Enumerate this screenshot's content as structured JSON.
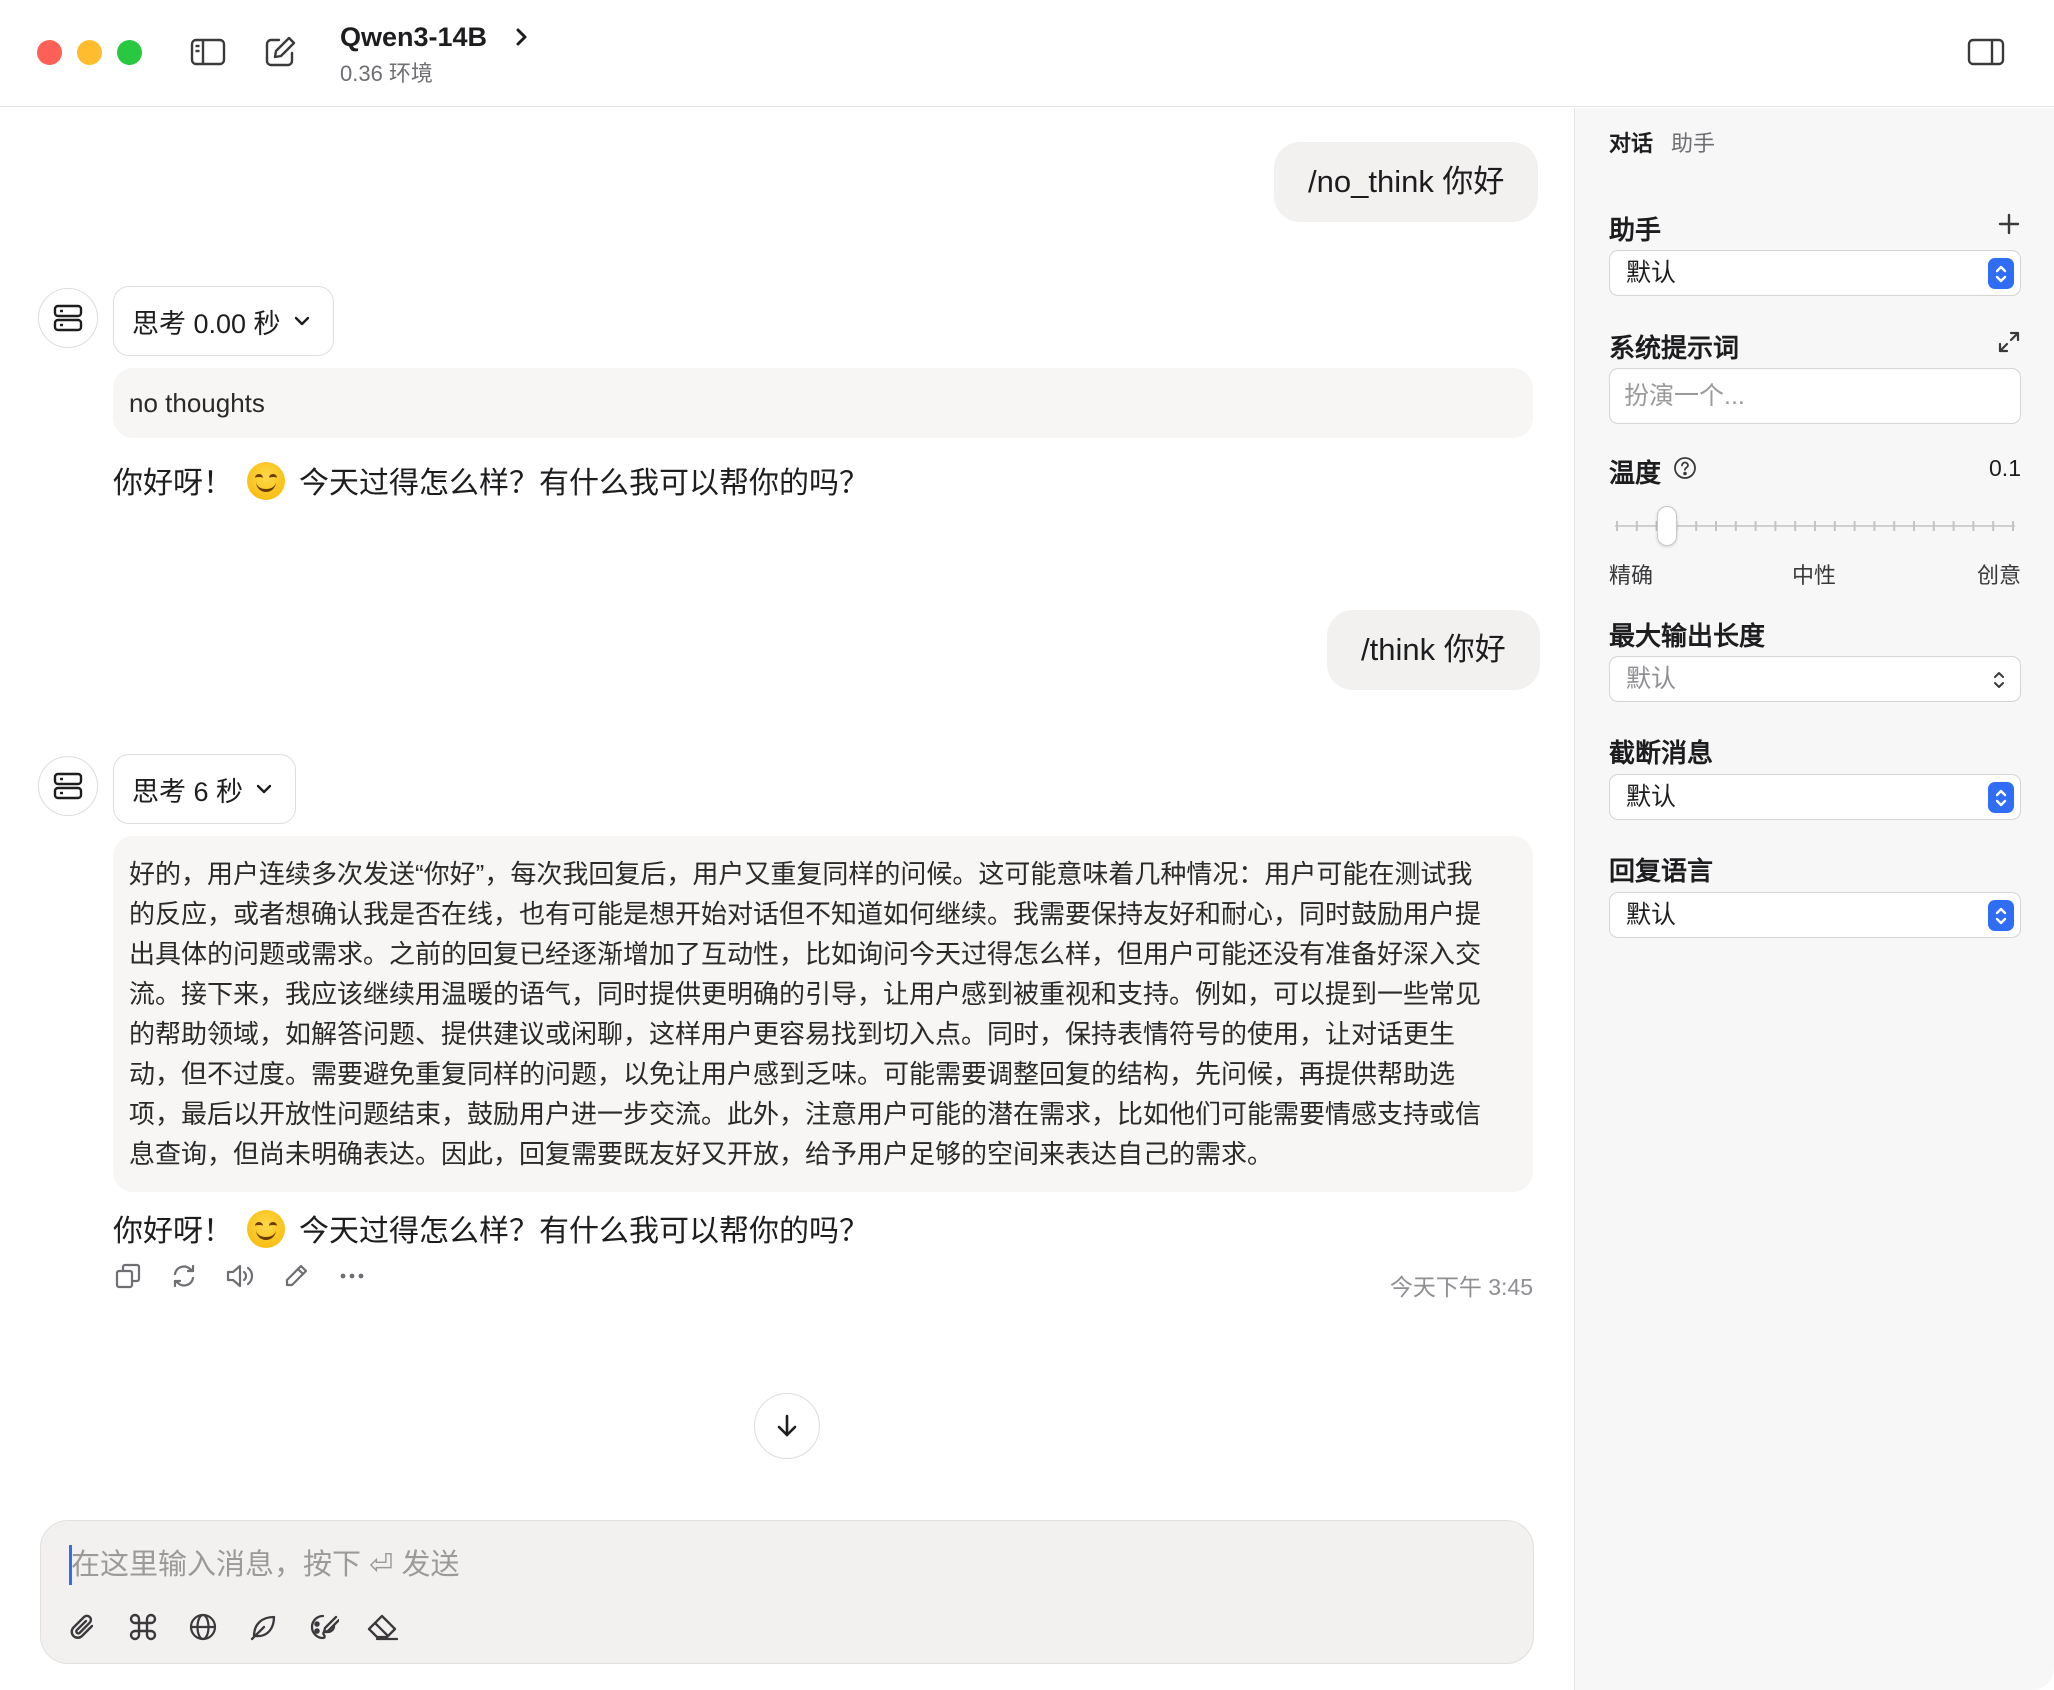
{
  "window": {
    "model_name": "Qwen3-14B",
    "model_subtitle": "0.36 环境"
  },
  "conversation": {
    "user_message_1": "/no_think 你好",
    "thinking_1": {
      "label": "思考 0.00 秒",
      "content": "no thoughts"
    },
    "answer_1": {
      "before_emoji": "你好呀！",
      "emoji": "smiling-face",
      "after_emoji": "今天过得怎么样？有什么我可以帮你的吗？"
    },
    "user_message_2": "/think 你好",
    "thinking_2": {
      "label": "思考 6 秒",
      "content": "好的，用户连续多次发送“你好”，每次我回复后，用户又重复同样的问候。这可能意味着几种情况：用户可能在测试我的反应，或者想确认我是否在线，也有可能是想开始对话但不知道如何继续。我需要保持友好和耐心，同时鼓励用户提出具体的问题或需求。之前的回复已经逐渐增加了互动性，比如询问今天过得怎么样，但用户可能还没有准备好深入交流。接下来，我应该继续用温暖的语气，同时提供更明确的引导，让用户感到被重视和支持。例如，可以提到一些常见的帮助领域，如解答问题、提供建议或闲聊，这样用户更容易找到切入点。同时，保持表情符号的使用，让对话更生动，但不过度。需要避免重复同样的问题，以免让用户感到乏味。可能需要调整回复的结构，先问候，再提供帮助选项，最后以开放性问题结束，鼓励用户进一步交流。此外，注意用户可能的潜在需求，比如他们可能需要情感支持或信息查询，但尚未明确表达。因此，回复需要既友好又开放，给予用户足够的空间来表达自己的需求。"
    },
    "answer_2": {
      "before_emoji": "你好呀！",
      "emoji": "smiling-face",
      "after_emoji": "今天过得怎么样？有什么我可以帮你的吗？"
    },
    "timestamp": "今天下午 3:45"
  },
  "composer": {
    "placeholder_prefix": "在这里输入消息，按下",
    "placeholder_key": "⏎",
    "placeholder_suffix": "发送"
  },
  "sidebar": {
    "tabs": [
      {
        "label": "对话",
        "active": true
      },
      {
        "label": "助手",
        "active": false
      }
    ],
    "assistant": {
      "label": "助手",
      "value": "默认"
    },
    "system_prompt": {
      "label": "系统提示词",
      "placeholder": "扮演一个..."
    },
    "temperature": {
      "label": "温度",
      "value": "0.1",
      "level": 0.1,
      "min_label": "精确",
      "mid_label": "中性",
      "max_label": "创意"
    },
    "max_output": {
      "label": "最大输出长度",
      "value": "默认"
    },
    "truncate": {
      "label": "截断消息",
      "value": "默认"
    },
    "reply_language": {
      "label": "回复语言",
      "value": "默认"
    }
  },
  "colors": {
    "accent": "#2f6df5",
    "bubble": "#f3f1f0",
    "traffic_red": "#fe5f57",
    "traffic_yellow": "#febc2e",
    "traffic_green": "#28c840"
  }
}
